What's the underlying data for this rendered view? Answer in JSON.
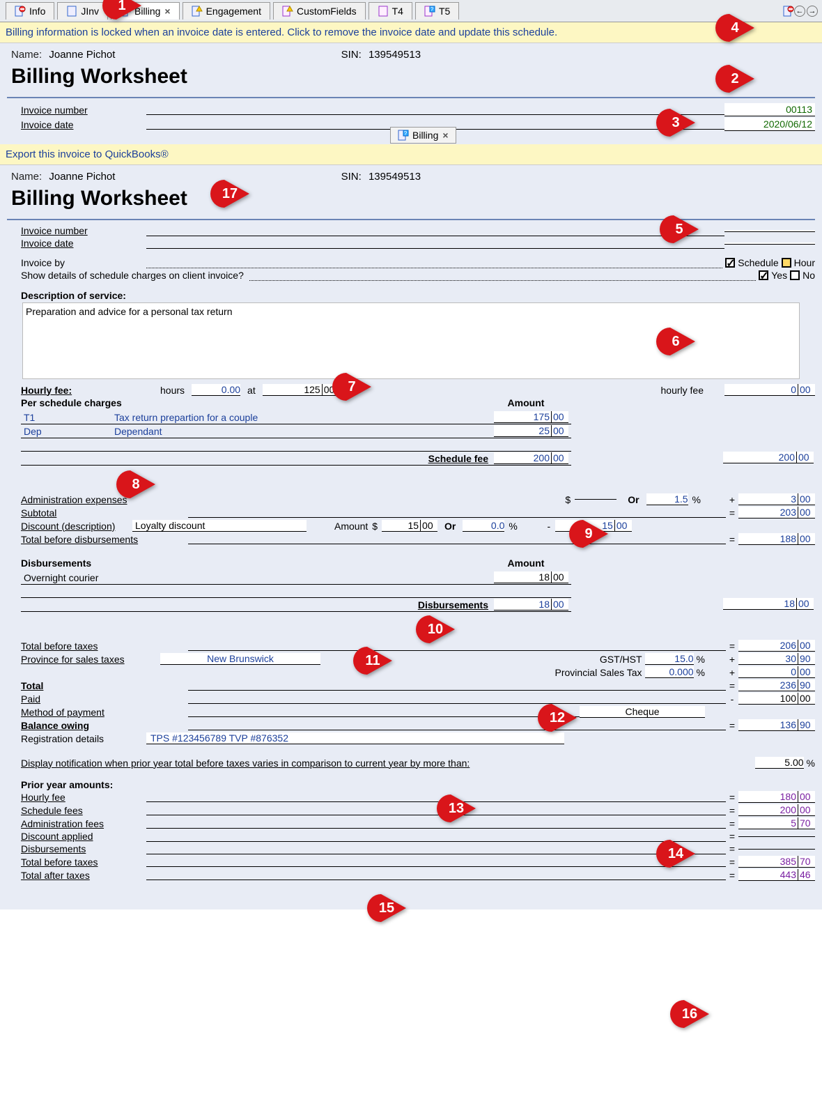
{
  "tabs": [
    "Info",
    "JInv",
    "Billing",
    "Engagement",
    "CustomFields",
    "T4",
    "T5"
  ],
  "banner1": "Billing information is locked when an invoice date is entered. Click to remove the invoice date and update this schedule.",
  "banner2": "Export this invoice to QuickBooks®",
  "nameLabel": "Name:",
  "name": "Joanne Pichot",
  "sinLabel": "SIN:",
  "sin": "139549513",
  "title": "Billing Worksheet",
  "invNumLabel": "Invoice number",
  "invNum": "00113",
  "invDateLabel": "Invoice date",
  "invDate": "2020/06/12",
  "inlineTab": "Billing",
  "invoiceByLabel": "Invoice by",
  "schedule": "Schedule",
  "hour": "Hour",
  "showDetails": "Show details of schedule charges on client invoice?",
  "yes": "Yes",
  "no": "No",
  "descLabel": "Description of service:",
  "desc": "Preparation and advice for a personal tax return",
  "hourlyFeeLabel": "Hourly fee:",
  "hoursLabel": "hours",
  "hoursVal": "0.00",
  "atLabel": "at",
  "rateWhole": "125",
  "rateDec": "00",
  "hourlyFeeText": "hourly fee",
  "hourlyFeeWhole": "0",
  "hourlyFeeDec": "00",
  "perSchedule": "Per schedule charges",
  "amount": "Amount",
  "sched": [
    {
      "code": "T1",
      "desc": "Tax return prepartion for a couple",
      "w": "175",
      "d": "00"
    },
    {
      "code": "Dep",
      "desc": "Dependant",
      "w": "25",
      "d": "00"
    }
  ],
  "scheduleFee": "Schedule fee",
  "sfW": "200",
  "sfD": "00",
  "adminExp": "Administration expenses",
  "or": "Or",
  "adminPct": "1.5",
  "adminW": "3",
  "adminD": "00",
  "subtotal": "Subtotal",
  "subW": "203",
  "subD": "00",
  "discountDesc": "Discount (description)",
  "discountName": "Loyalty discount",
  "amountLabel": "Amount",
  "discW": "15",
  "discD": "00",
  "discPct": "0.0",
  "discTotW": "15",
  "discTotD": "00",
  "tbd": "Total before disbursements",
  "tbdW": "188",
  "tbdD": "00",
  "disbursements": "Disbursements",
  "disbItem": "Overnight courier",
  "disbItemW": "18",
  "disbItemD": "00",
  "disbTotW": "18",
  "disbTotD": "00",
  "tbt": "Total before taxes",
  "tbtW": "206",
  "tbtD": "00",
  "provLabel": "Province for sales taxes",
  "prov": "New Brunswick",
  "gst": "GST/HST",
  "gstPct": "15.0",
  "gstW": "30",
  "gstD": "90",
  "pst": "Provincial Sales Tax",
  "pstPct": "0.000",
  "pstW": "0",
  "pstD": "00",
  "total": "Total",
  "totW": "236",
  "totD": "90",
  "paid": "Paid",
  "paidW": "100",
  "paidD": "00",
  "method": "Method of payment",
  "methodVal": "Cheque",
  "balance": "Balance owing",
  "balW": "136",
  "balD": "90",
  "regLabel": "Registration details",
  "reg": "TPS #123456789 TVP #876352",
  "notify": "Display notification when prior year total before taxes varies in comparison to current year by more than:",
  "notifyPct": "5.00",
  "prior": "Prior year amounts:",
  "pHourly": "Hourly fee",
  "pHW": "180",
  "pHD": "00",
  "pSched": "Schedule fees",
  "pSW": "200",
  "pSD": "00",
  "pAdmin": "Administration fees",
  "pAW": "5",
  "pAD": "70",
  "pDisc": "Discount applied",
  "pDisb": "Disbursements",
  "pTbt": "Total before taxes",
  "pTW": "385",
  "pTD": "70",
  "pTat": "Total after taxes",
  "pTAW": "443",
  "pTAD": "46",
  "dollar": "$",
  "pct": "%"
}
